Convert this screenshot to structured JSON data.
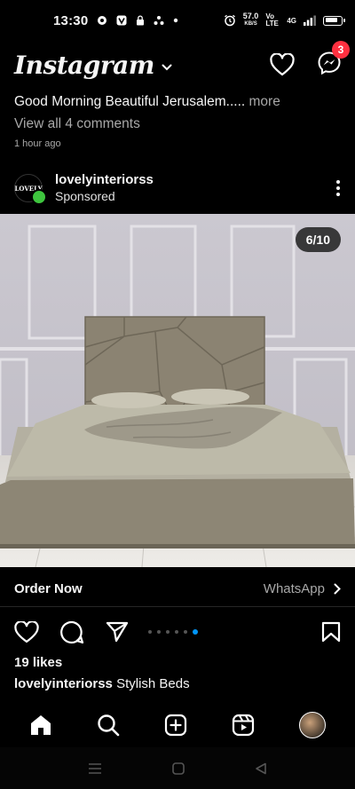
{
  "status_bar": {
    "time": "13:30",
    "speed": "57.0",
    "speed_unit": "KB/S",
    "network": "Vo LTE",
    "signal": "4G"
  },
  "header": {
    "logo": "Instagram",
    "notifications_badge": "3"
  },
  "previous_post": {
    "caption": "Good Morning Beautiful Jerusalem.....",
    "more": "more",
    "view_comments": "View all 4 comments",
    "time_ago": "1 hour ago"
  },
  "post": {
    "avatar_text": "LOVELY",
    "username": "lovelyinteriorss",
    "sponsored": "Sponsored",
    "image_counter": "6/10",
    "cta_label": "Order Now",
    "cta_action": "WhatsApp",
    "carousel": {
      "count": 6,
      "active_index": 5
    },
    "likes": "19 likes",
    "caption_user": "lovelyinteriorss",
    "caption_text": "Stylish Beds"
  },
  "colors": {
    "background": "#000000",
    "badge": "#ff3040",
    "accent": "#0095f6",
    "muted_text": "#a8a8a8"
  },
  "icons": {
    "header": [
      "heart-icon",
      "messenger-icon"
    ],
    "actions": [
      "heart-icon",
      "comment-icon",
      "share-icon",
      "bookmark-icon"
    ],
    "bottom_nav": [
      "home-icon",
      "search-icon",
      "create-icon",
      "reels-icon",
      "profile-avatar"
    ],
    "system_nav": [
      "recents-icon",
      "home-button-icon",
      "back-icon"
    ]
  }
}
